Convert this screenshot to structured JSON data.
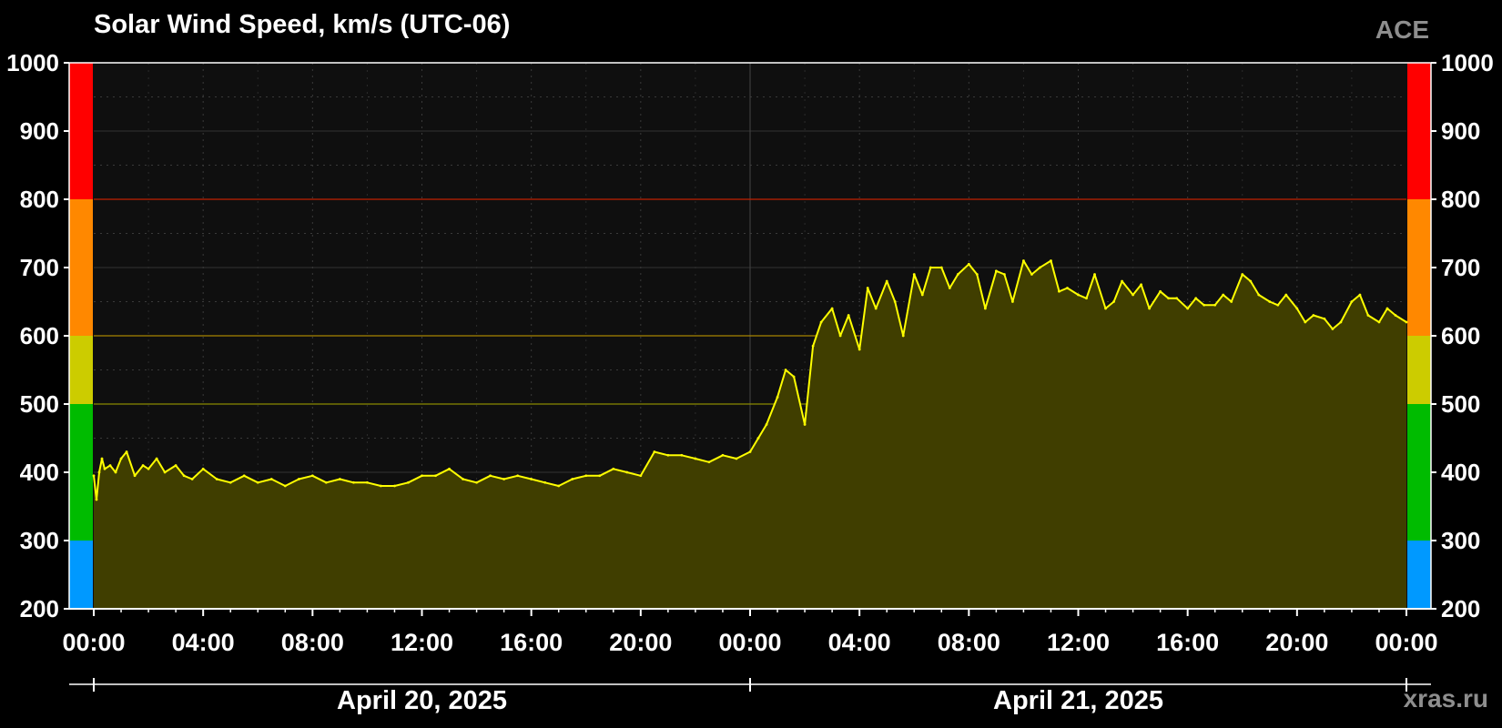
{
  "chart_data": {
    "type": "area",
    "title": "Solar Wind Speed, km/s (UTC-06)",
    "source": "ACE",
    "watermark": "xras.ru",
    "ylim": [
      200,
      1000
    ],
    "yticks": [
      "200",
      "300",
      "400",
      "500",
      "600",
      "700",
      "800",
      "900",
      "1000"
    ],
    "y_major": [
      200,
      300,
      400,
      500,
      600,
      700,
      800,
      900,
      1000
    ],
    "y_minor": [
      250,
      350,
      450,
      550,
      650,
      750,
      850,
      950
    ],
    "threshold_lines": [
      {
        "value": 500,
        "color": "#8a8a00"
      },
      {
        "value": 600,
        "color": "#a88400"
      },
      {
        "value": 800,
        "color": "#c02000"
      }
    ],
    "color_bands": [
      {
        "from": 200,
        "to": 300,
        "color": "#0099ff"
      },
      {
        "from": 300,
        "to": 500,
        "color": "#00bb00"
      },
      {
        "from": 500,
        "to": 600,
        "color": "#cccc00"
      },
      {
        "from": 600,
        "to": 800,
        "color": "#ff8800"
      },
      {
        "from": 800,
        "to": 1000,
        "color": "#ff0000"
      }
    ],
    "x_hours_range": [
      0,
      48
    ],
    "xticks": [
      {
        "hour": 0,
        "label": "00:00"
      },
      {
        "hour": 4,
        "label": "04:00"
      },
      {
        "hour": 8,
        "label": "08:00"
      },
      {
        "hour": 12,
        "label": "12:00"
      },
      {
        "hour": 16,
        "label": "16:00"
      },
      {
        "hour": 20,
        "label": "20:00"
      },
      {
        "hour": 24,
        "label": "00:00"
      },
      {
        "hour": 28,
        "label": "04:00"
      },
      {
        "hour": 32,
        "label": "08:00"
      },
      {
        "hour": 36,
        "label": "12:00"
      },
      {
        "hour": 40,
        "label": "16:00"
      },
      {
        "hour": 44,
        "label": "20:00"
      },
      {
        "hour": 48,
        "label": "00:00"
      }
    ],
    "dates": [
      {
        "label": "April 20, 2025",
        "center_hour": 12
      },
      {
        "label": "April 21, 2025",
        "center_hour": 36
      }
    ],
    "grid": true,
    "series": [
      {
        "color": "#ffff00",
        "fill": "#403e00",
        "x_hours": [
          0.0,
          0.1,
          0.2,
          0.3,
          0.4,
          0.6,
          0.8,
          1.0,
          1.2,
          1.5,
          1.8,
          2.0,
          2.3,
          2.6,
          3.0,
          3.3,
          3.6,
          4.0,
          4.5,
          5.0,
          5.5,
          6.0,
          6.5,
          7.0,
          7.5,
          8.0,
          8.5,
          9.0,
          9.5,
          10.0,
          10.5,
          11.0,
          11.5,
          12.0,
          12.5,
          13.0,
          13.5,
          14.0,
          14.5,
          15.0,
          15.5,
          16.0,
          16.5,
          17.0,
          17.5,
          18.0,
          18.5,
          19.0,
          19.5,
          20.0,
          20.5,
          21.0,
          21.5,
          22.0,
          22.5,
          23.0,
          23.5,
          24.0,
          24.3,
          24.6,
          25.0,
          25.3,
          25.6,
          26.0,
          26.3,
          26.6,
          27.0,
          27.3,
          27.6,
          28.0,
          28.3,
          28.6,
          29.0,
          29.3,
          29.6,
          30.0,
          30.3,
          30.6,
          31.0,
          31.3,
          31.6,
          32.0,
          32.3,
          32.6,
          33.0,
          33.3,
          33.6,
          34.0,
          34.3,
          34.6,
          35.0,
          35.3,
          35.6,
          36.0,
          36.3,
          36.6,
          37.0,
          37.3,
          37.6,
          38.0,
          38.3,
          38.6,
          39.0,
          39.3,
          39.6,
          40.0,
          40.3,
          40.6,
          41.0,
          41.3,
          41.6,
          42.0,
          42.3,
          42.6,
          43.0,
          43.3,
          43.6,
          44.0,
          44.3,
          44.6,
          45.0,
          45.3,
          45.6,
          46.0,
          46.3,
          46.6,
          47.0,
          47.3,
          47.6,
          48.0
        ],
        "values": [
          395,
          360,
          400,
          420,
          405,
          410,
          400,
          420,
          430,
          395,
          410,
          405,
          420,
          400,
          410,
          395,
          390,
          405,
          390,
          385,
          395,
          385,
          390,
          380,
          390,
          395,
          385,
          390,
          385,
          385,
          380,
          380,
          385,
          395,
          395,
          405,
          390,
          385,
          395,
          390,
          395,
          390,
          385,
          380,
          390,
          395,
          395,
          405,
          400,
          395,
          430,
          425,
          425,
          420,
          415,
          425,
          420,
          430,
          450,
          470,
          510,
          550,
          540,
          470,
          585,
          620,
          640,
          600,
          630,
          580,
          670,
          640,
          680,
          650,
          600,
          690,
          660,
          700,
          700,
          670,
          690,
          705,
          690,
          640,
          695,
          690,
          650,
          710,
          690,
          700,
          710,
          665,
          670,
          660,
          655,
          690,
          640,
          650,
          680,
          660,
          675,
          640,
          665,
          655,
          655,
          640,
          655,
          645,
          645,
          660,
          650,
          690,
          680,
          660,
          650,
          645,
          660,
          640,
          620,
          630,
          625,
          610,
          620,
          650,
          660,
          630,
          620,
          640,
          630,
          620
        ]
      }
    ]
  }
}
